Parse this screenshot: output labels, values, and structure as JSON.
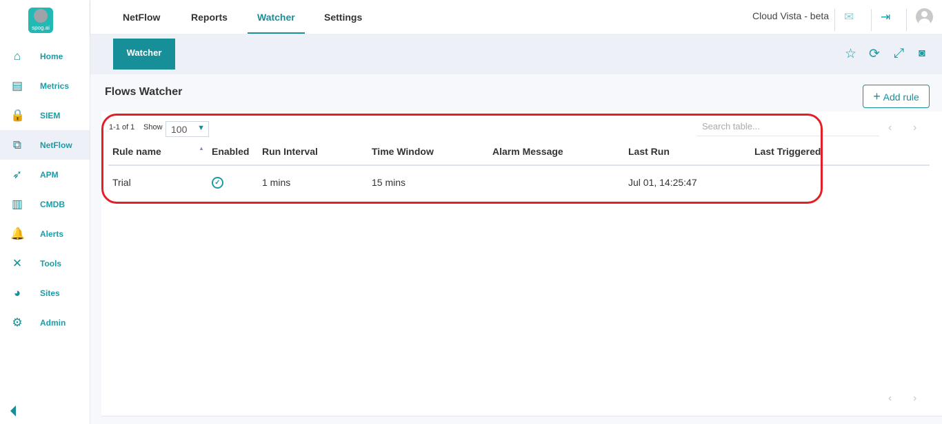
{
  "logo": {
    "text": "spog.ai"
  },
  "sidebar": {
    "items": [
      {
        "label": "Home",
        "icon": "home-icon",
        "glyph": "⌂"
      },
      {
        "label": "Metrics",
        "icon": "metrics-icon",
        "glyph": "▤"
      },
      {
        "label": "SIEM",
        "icon": "lock-icon",
        "glyph": "🔒"
      },
      {
        "label": "NetFlow",
        "icon": "network-icon",
        "glyph": "⧉"
      },
      {
        "label": "APM",
        "icon": "rocket-icon",
        "glyph": "➶"
      },
      {
        "label": "CMDB",
        "icon": "barcode-icon",
        "glyph": "▥"
      },
      {
        "label": "Alerts",
        "icon": "bell-icon",
        "glyph": "🔔"
      },
      {
        "label": "Tools",
        "icon": "tools-icon",
        "glyph": "✕"
      },
      {
        "label": "Sites",
        "icon": "globe-icon",
        "glyph": "◕"
      },
      {
        "label": "Admin",
        "icon": "gear-icon",
        "glyph": "⚙"
      }
    ],
    "active": "NetFlow"
  },
  "topnav": {
    "tabs": [
      "NetFlow",
      "Reports",
      "Watcher",
      "Settings"
    ],
    "active": "Watcher",
    "brand": "Cloud Vista - beta"
  },
  "band": {
    "tab": "Watcher"
  },
  "page": {
    "title": "Flows Watcher",
    "add_rule": "Add rule"
  },
  "table": {
    "count": "1-1 of 1",
    "show_label": "Show",
    "page_size": "100",
    "search_placeholder": "Search table...",
    "columns": [
      "Rule name",
      "Enabled",
      "Run Interval",
      "Time Window",
      "Alarm Message",
      "Last Run",
      "Last Triggered"
    ],
    "rows": [
      {
        "rule_name": "Trial",
        "enabled": true,
        "run_interval": "1 mins",
        "time_window": "15 mins",
        "alarm_message": "",
        "last_run": "Jul 01, 14:25:47",
        "last_triggered": ""
      }
    ]
  },
  "colors": {
    "accent": "#178f99",
    "annotation": "#e41e26"
  }
}
